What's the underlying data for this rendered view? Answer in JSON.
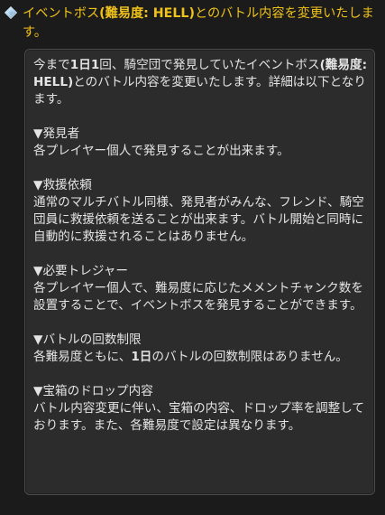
{
  "header": {
    "title_parts": [
      {
        "text": "イベントボス",
        "bold": false
      },
      {
        "text": "(難易度: HELL)",
        "bold": true
      },
      {
        "text": "とのバトル内容を変更いたします。",
        "bold": false
      }
    ]
  },
  "content": {
    "intro_parts": [
      {
        "text": "今まで",
        "bold": false
      },
      {
        "text": "1日1",
        "bold": true
      },
      {
        "text": "回、騎空団で発見していたイベントボス",
        "bold": false
      },
      {
        "text": "(難易度: HELL)",
        "bold": true
      },
      {
        "text": "とのバトル内容を変更いたします。詳細は以下となります。",
        "bold": false
      }
    ],
    "sections": [
      {
        "title": "▼発見者",
        "body_parts": [
          {
            "text": "各プレイヤー個人で発見することが出来ます。",
            "bold": false
          }
        ]
      },
      {
        "title": "▼救援依頼",
        "body_parts": [
          {
            "text": "通常のマルチバトル同様、発見者がみんな、フレンド、騎空団員に救援依頼を送ることが出来ます。バトル開始と同時に自動的に救援されることはありません。",
            "bold": false
          }
        ]
      },
      {
        "title": "▼必要トレジャー",
        "body_parts": [
          {
            "text": "各プレイヤー個人で、難易度に応じたメメントチャンク数を設置することで、イベントボスを発見することができます。",
            "bold": false
          }
        ]
      },
      {
        "title": "▼バトルの回数制限",
        "body_parts": [
          {
            "text": "各難易度ともに、",
            "bold": false
          },
          {
            "text": "1日",
            "bold": true
          },
          {
            "text": "のバトルの回数制限はありません。",
            "bold": false
          }
        ]
      },
      {
        "title": "▼宝箱のドロップ内容",
        "body_parts": [
          {
            "text": "バトル内容変更に伴い、宝箱の内容、ドロップ率を調整しております。また、各難易度で設定は異なります。",
            "bold": false
          }
        ]
      }
    ]
  },
  "colors": {
    "title": "#f0c21a",
    "body_text": "#e4e4e4",
    "panel_bg": "#2c2c2c",
    "page_bg": "#1b1b1b",
    "icon": "#9ec9e6"
  },
  "icons": {
    "header_icon": "diamond-icon"
  }
}
